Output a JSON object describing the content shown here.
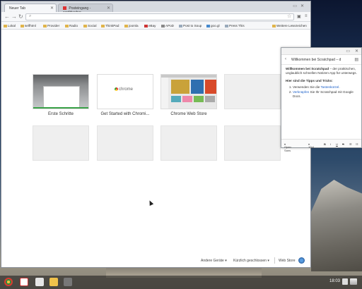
{
  "browser": {
    "tabs": [
      {
        "label": "Neuer Tab",
        "active": true
      },
      {
        "label": "Posteingang - zapfdweber",
        "active": false
      }
    ],
    "omnibox": {
      "value": ""
    },
    "bookmarks": [
      {
        "label": "Lokal"
      },
      {
        "label": "selfhtml"
      },
      {
        "label": "Provider"
      },
      {
        "label": "Radio"
      },
      {
        "label": "Social"
      },
      {
        "label": "ThinkPad"
      },
      {
        "label": "joomla"
      },
      {
        "label": "eBay"
      },
      {
        "label": "APoD"
      },
      {
        "label": "Post to Soup"
      },
      {
        "label": "goo.gl"
      },
      {
        "label": "Press This"
      },
      {
        "label": "Weitere Lesezeichen"
      }
    ]
  },
  "new_tab": {
    "tiles": [
      {
        "label": "Erste Schritte"
      },
      {
        "label": "Get Started with Chromi..."
      },
      {
        "label": "Chrome Web Store"
      }
    ],
    "thumb2_text": "chrome",
    "footer": {
      "other_devices": "Andere Geräte",
      "recently_closed": "Kürzlich geschlossen",
      "web_store": "Web Store"
    }
  },
  "scratchpad": {
    "title": "Willkommen bei Scratchpad – d",
    "intro_bold": "Willkommen bei Scratchpad",
    "intro_rest": " – der praktischen, unglaublich schnellen Notizen-App für unterwegs.",
    "tips_heading": "Hier sind die Tipps und Tricks:",
    "tip1_prefix": "Verwenden Sie die ",
    "tip1_link": "Tastenkürzel",
    "tip1_suffix": ".",
    "tip2_link": "Verknüpfen",
    "tip2_rest": " Sie Ihr Scratchpad mit Google Docs.",
    "toolbar": {
      "font": "Open Sans",
      "size": "10pt",
      "bold": "B",
      "italic": "I",
      "underline": "U",
      "strike": "S"
    }
  },
  "shelf": {
    "clock": "18:03"
  },
  "icons": [
    "search-icon",
    "star-icon",
    "back-icon",
    "forward-icon",
    "reload-icon",
    "menu-icon",
    "folder-icon",
    "gmail-icon",
    "files-icon",
    "web-store-icon"
  ],
  "colors": {
    "link": "#1a5fc8",
    "tab_strip": "#d7dbe1",
    "accent_green": "#3aa148"
  }
}
